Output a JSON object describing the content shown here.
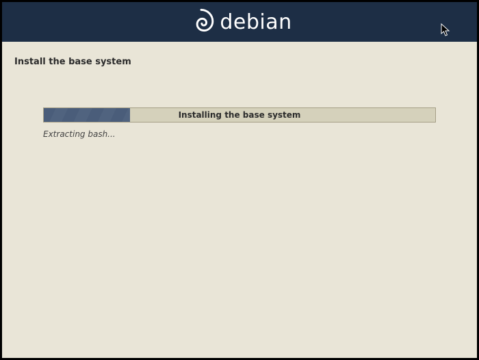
{
  "header": {
    "brand": "debian",
    "logo_name": "debian-swirl"
  },
  "page": {
    "title": "Install the base system"
  },
  "progress": {
    "label": "Installing the base system",
    "percent": 22,
    "status": "Extracting bash..."
  }
}
